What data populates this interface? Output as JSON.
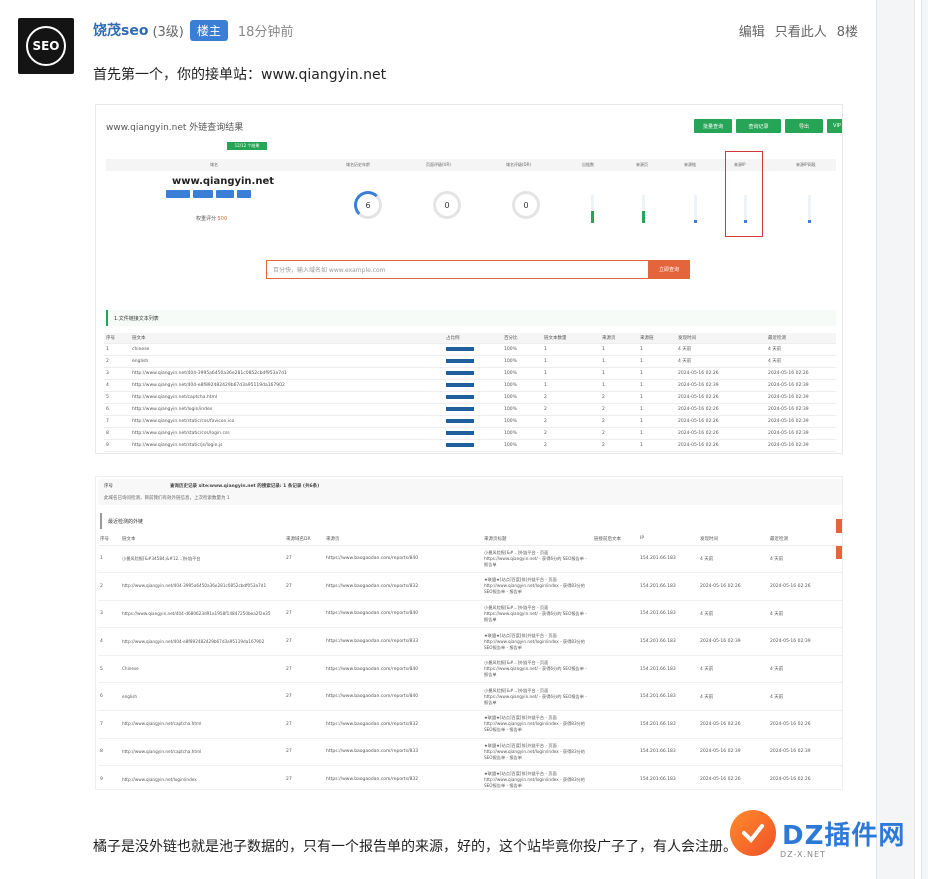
{
  "post": {
    "avatar_text": "SEO",
    "username": "饶茂seo",
    "level": "(3级)",
    "badge": "楼主",
    "time": "18分钟前",
    "actions": [
      "编辑",
      "只看此人",
      "8楼"
    ],
    "para1": "首先第一个，你的接单站：www.qiangyin.net",
    "para2": "橘子是没外链也就是池子数据的，只有一个报告单的来源，好的，这个站毕竟你投广子了，有人会注册。"
  },
  "shot1": {
    "title": "www.qiangyin.net 外链查询结果",
    "toolbar": [
      "批量查询",
      "查询记录",
      "导出",
      "VIP"
    ],
    "badge": "12/12 个结果",
    "headers": [
      "域名",
      "域名历史年龄",
      "页面评级(UR)",
      "域名评级(DR)",
      "出链数",
      "来源页",
      "来源链",
      "来源IP",
      "来源IP网段"
    ],
    "domain": "www.qiangyin.net",
    "score_label": "权重评分",
    "score": "500",
    "metrics": [
      "6",
      "0",
      "0"
    ],
    "search_placeholder": "百分快，输入域名如 www.example.com",
    "search_button": "立即查询",
    "section": "1.文件链接文本列表",
    "table_headers": [
      "序号",
      "链文本",
      "占比例",
      "百分比",
      "链文本数量",
      "来源页",
      "来源链",
      "发现时间",
      "最近检测"
    ],
    "rows": [
      [
        "1",
        "chinese",
        "100%",
        "1",
        "1",
        "1",
        "4 天前",
        "4 天前"
      ],
      [
        "2",
        "english",
        "100%",
        "1",
        "1",
        "1",
        "4 天前",
        "4 天前"
      ],
      [
        "3",
        "http://www.qiangyin.net/404-3995a6450a36e281c0852cbdf953a7d1",
        "100%",
        "1",
        "1",
        "1",
        "2024-05-16 02:26",
        "2024-05-16 02:26"
      ],
      [
        "4",
        "http://www.qiangyin.net/404-e8f892482429b67d3a95119da167902",
        "100%",
        "1",
        "1",
        "1",
        "2024-05-16 02:39",
        "2024-05-16 02:39"
      ],
      [
        "5",
        "http://www.qiangyin.net/captcha.html",
        "100%",
        "2",
        "2",
        "1",
        "2024-05-16 02:26",
        "2024-05-16 02:39"
      ],
      [
        "6",
        "http://www.qiangyin.net/login/index",
        "100%",
        "2",
        "2",
        "1",
        "2024-05-16 02:26",
        "2024-05-16 02:39"
      ],
      [
        "7",
        "http://www.qiangyin.net/static/css/favicon.ico",
        "100%",
        "2",
        "2",
        "1",
        "2024-05-16 02:26",
        "2024-05-16 02:39"
      ],
      [
        "8",
        "http://www.qiangyin.net/static/css/login.css",
        "100%",
        "2",
        "2",
        "1",
        "2024-05-16 02:26",
        "2024-05-16 02:39"
      ],
      [
        "9",
        "http://www.qiangyin.net/static/js/login.js",
        "100%",
        "2",
        "2",
        "1",
        "2024-05-16 02:26",
        "2024-05-16 02:39"
      ]
    ]
  },
  "shot2": {
    "top_left": "序号",
    "top_title": "查询历史记录 site:www.qiangyin.net 的搜索记录: 1 条记录 (共6条)",
    "top_note": "此域名已询问检测，目前我们有效外链信息，上次检索数量为 1",
    "section": "最近检测的外链",
    "headers": [
      "序号",
      "链文本",
      "来源域名DR",
      "来源页",
      "来源页标题",
      "链接前后文本",
      "IP",
      "发现时间",
      "最近检测"
    ],
    "rows": [
      [
        "1",
        "小曼风险报[&#34584;&#12...]外链平台",
        "27",
        "https://www.baogaodan.com/reports/840",
        "小曼风险报[&#...]外链平台 - 页面 https://www.qiangyin.net/ - 获得6分的 SEO报告单 - 报告单",
        "",
        "154.201.66.183",
        "4 天前",
        "4 天前"
      ],
      [
        "2",
        "http://www.qiangyin.net/404-3995a6450a36e281c0852cbdf053a7d1",
        "27",
        "https://www.baogaodan.com/reports/832",
        "★联盟★[站点]百度[排]外链平台 - 页面 http://www.qiangyin.net/login/index - 获得83分的SEO报告单 - 报告单",
        "",
        "154.201.66.183",
        "2024-05-16 02:26",
        "2024-05-16 02:26"
      ],
      [
        "3",
        "https://www.qiangyin.net/404-d680623d91a1958f14847250bea2f2e35",
        "27",
        "https://www.baogaodan.com/reports/840",
        "小曼风险报[&#...]外链平台 - 页面 https://www.qiangyin.net/ - 获得6分的 SEO报告单 - 报告单",
        "",
        "154.201.66.183",
        "4 天前",
        "4 天前"
      ],
      [
        "4",
        "http://www.qiangyin.net/404-e8f892482429b67d3a95119da167902",
        "27",
        "https://www.baogaodan.com/reports/833",
        "★联盟★[站点]百度[排]外链平台 - 页面 http://www.qiangyin.net/login/index - 获得83分的SEO报告单 - 报告单",
        "",
        "154.201.66.183",
        "2024-05-16 02:39",
        "2024-05-16 02:39"
      ],
      [
        "5",
        "Chinese",
        "27",
        "https://www.baogaodan.com/reports/840",
        "小曼风险报[&#...]外链平台 - 页面 https://www.qiangyin.net/ - 获得6分的 SEO报告单 - 报告单",
        "",
        "154.201.66.183",
        "4 天前",
        "4 天前"
      ],
      [
        "6",
        "english",
        "27",
        "https://www.baogaodan.com/reports/840",
        "小曼风险报[&#...]外链平台 - 页面 https://www.qiangyin.net/ - 获得6分的 SEO报告单 - 报告单",
        "",
        "154.201.66.183",
        "4 天前",
        "4 天前"
      ],
      [
        "7",
        "http://www.qiangyin.net/captcha.html",
        "27",
        "https://www.baogaodan.com/reports/832",
        "★联盟★[站点]百度[排]外链平台 - 页面 http://www.qiangyin.net/login/index - 获得83分的SEO报告单 - 报告单",
        "",
        "154.201.66.183",
        "2024-05-16 02:26",
        "2024-05-16 02:26"
      ],
      [
        "8",
        "http://www.qiangyin.net/captcha.html",
        "27",
        "https://www.baogaodan.com/reports/833",
        "★联盟★[站点]百度[排]外链平台 - 页面 http://www.qiangyin.net/login/index - 获得83分的SEO报告单 - 报告单",
        "",
        "154.201.66.183",
        "2024-05-16 02:39",
        "2024-05-16 02:39"
      ],
      [
        "9",
        "http://www.qiangyin.net/login/index",
        "27",
        "https://www.baogaodan.com/reports/832",
        "★联盟★[站点]百度[排]外链平台 - 页面 http://www.qiangyin.net/login/index - 获得83分的SEO报告单 - 报告单",
        "",
        "154.201.66.183",
        "2024-05-16 02:26",
        "2024-05-16 02:26"
      ]
    ]
  },
  "watermark": {
    "text": "DZ插件网",
    "url": "DZ-X.NET"
  },
  "colors": {
    "accent": "#3a7ed6",
    "green": "#27a556",
    "orange": "#e4643c",
    "red_box": "#d03a3a"
  }
}
